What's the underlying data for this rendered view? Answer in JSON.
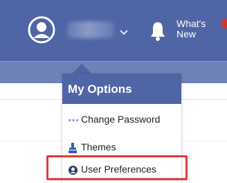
{
  "header": {
    "whats_new_line1": "What's",
    "whats_new_line2": "New",
    "icons": {
      "avatar": "user-circle-icon",
      "chevron": "chevron-down-icon",
      "bell": "bell-icon"
    },
    "colors": {
      "header_bg": "#4f65a6",
      "subbar_bg": "#6f82b8",
      "badge": "#d4352e"
    }
  },
  "dropdown": {
    "title": "My Options",
    "items": [
      {
        "label": "Change Password",
        "icon": "password-dots-icon"
      },
      {
        "label": "Themes",
        "icon": "paint-brush-icon"
      },
      {
        "label": "User Preferences",
        "icon": "user-circle-icon"
      }
    ],
    "highlight_color": "#e03a3c"
  }
}
